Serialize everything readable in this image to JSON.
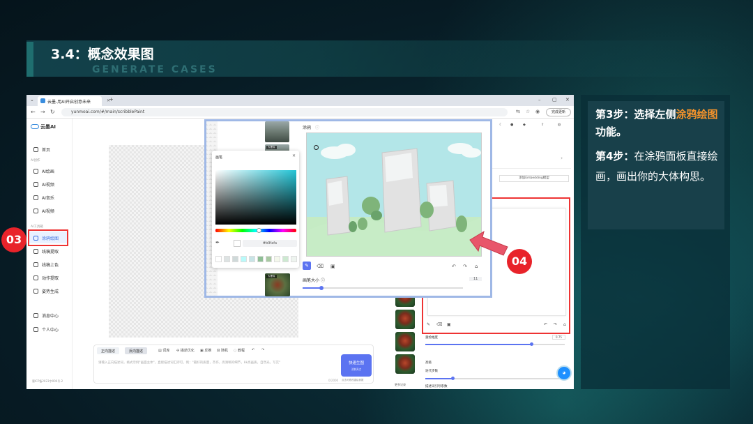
{
  "slide": {
    "title": "3.4：概念效果图",
    "subtitle": "GENERATE CASES"
  },
  "browser": {
    "tab_title": "云墨-用AI开启创意未来",
    "url": "yunmoai.com/#/main/scribblePaint",
    "update_label": "完成更新"
  },
  "app": {
    "logo": "云墨AI",
    "sidebar": {
      "home": "首页",
      "group_creation": "AI创作",
      "ai_drawing": "AI绘画",
      "ai_video": "AI视频",
      "ai_music": "AI音乐",
      "ai_video2": "AI视频",
      "group_tools": "AI工具箱",
      "scribble": "涂鸦绘图",
      "lineart_extract": "线稿提取",
      "lineart_color": "线稿上色",
      "motion_extract": "动作提取",
      "pose_gen": "姿势生成",
      "messages": "消息中心",
      "profile": "个人中心",
      "footer": "蜀ICP备2023字000号-2"
    },
    "prompt": {
      "tab_positive": "正向描述",
      "tab_negative": "反向描述",
      "tool_words": "词库",
      "tool_optimize": "描述优化",
      "tool_translate": "反推",
      "tool_random": "随机",
      "tool_tutorial": "教程",
      "placeholder": "请输入正向描述词，格式示例\"画面主体\"，直接描述词汇即可。例：\"最好的质量，杰作，高清晰的细节，8k高画质，自然光，写实\"",
      "counter": "0/2000",
      "generate_label": "快速生图",
      "generate_cost": "消耗8点",
      "generate_foot": "点击可修改重绘参数"
    },
    "thumbs_more": "更多记录",
    "right_panel": {
      "embedding_button": "添加Embedding模型",
      "redraw_label": "重绘幅度",
      "redraw_value": "0.75",
      "advanced_label": "高级",
      "steps_label": "迭代步数",
      "prompt_guidance_label": "描述词引导系数"
    },
    "brush_popup": {
      "picker_title": "画笔",
      "hex_value": "#b9fafa",
      "doodle_label": "涂鸦",
      "brush_size_label": "画笔大小",
      "brush_size_value": "11",
      "photo_tag": "大理寺",
      "photo_tag2": "大理寺"
    }
  },
  "callouts": {
    "badge_03": "03",
    "badge_04": "04"
  },
  "instructions": {
    "step3_prefix": "第3步：选择左侧",
    "step3_highlight": "涂鸦绘图",
    "step3_suffix": "功能。",
    "step4_prefix": "第4步：",
    "step4_text": "在涂鸦面板直接绘画，画出你的大体构思。"
  },
  "colors": {
    "accent_blue": "#5b73f1",
    "callout_red": "#e8232a",
    "highlight_orange": "#f5932b",
    "sketch_sky": "#b3e6e8"
  }
}
